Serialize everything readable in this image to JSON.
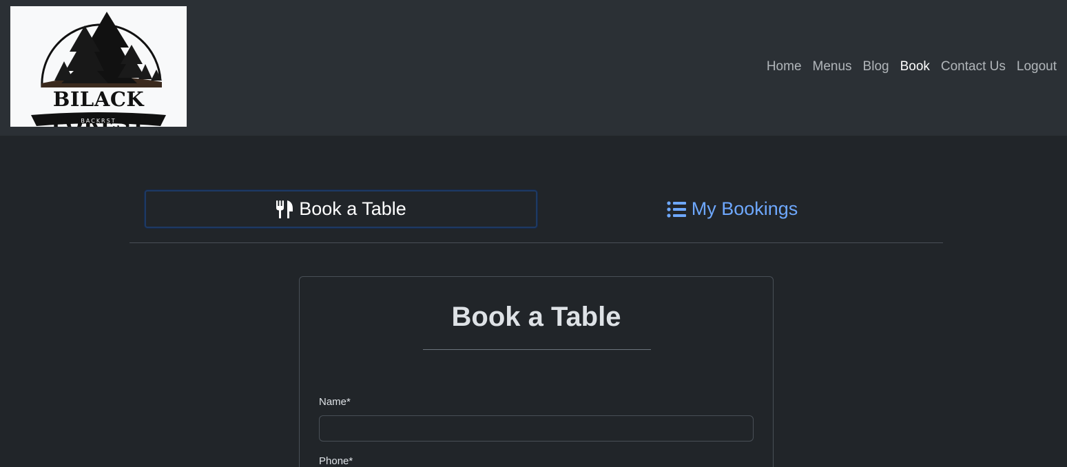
{
  "brand": {
    "logo_text": "BILACK FOREST",
    "logo_subtext": "BACKRST"
  },
  "nav": {
    "items": [
      {
        "label": "Home",
        "active": false
      },
      {
        "label": "Menus",
        "active": false
      },
      {
        "label": "Blog",
        "active": false
      },
      {
        "label": "Book",
        "active": true
      },
      {
        "label": "Contact Us",
        "active": false
      },
      {
        "label": "Logout",
        "active": false
      }
    ]
  },
  "tabs": {
    "book": {
      "label": "Book a Table",
      "icon": "utensils-icon",
      "active": true
    },
    "bookings": {
      "label": "My Bookings",
      "icon": "list-icon",
      "active": false
    }
  },
  "form": {
    "title": "Book a Table",
    "fields": [
      {
        "label": "Name*",
        "value": ""
      },
      {
        "label": "Phone*",
        "value": ""
      }
    ]
  },
  "colors": {
    "background": "#212529",
    "navbar": "#2b3035",
    "link_accent": "#6ea8fe",
    "active_tab_border": "#1e3a63"
  }
}
